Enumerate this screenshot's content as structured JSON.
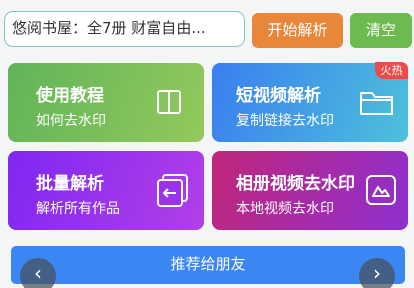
{
  "search": {
    "value": "悠阅书屋：全7册 财富自由..."
  },
  "buttons": {
    "parse": "开始解析",
    "clear": "清空"
  },
  "cards": {
    "tutorial": {
      "title": "使用教程",
      "subtitle": "如何去水印",
      "icon": "book-icon"
    },
    "short_video": {
      "title": "短视频解析",
      "subtitle": "复制链接去水印",
      "icon": "folder-icon",
      "badge": "火热"
    },
    "batch": {
      "title": "批量解析",
      "subtitle": "解析所有作品",
      "icon": "batch-files-icon"
    },
    "album": {
      "title": "相册视频去水印",
      "subtitle": "本地视频去水印",
      "icon": "picture-icon"
    }
  },
  "recommend": {
    "label": "推荐给朋友"
  },
  "nav": {
    "prev": "‹",
    "next": "›"
  },
  "colors": {
    "parse_button": "#e8863a",
    "clear_button": "#6dbb4e",
    "hot_badge": "#ee4c4c",
    "recommend_bar": "#3a86f2"
  }
}
